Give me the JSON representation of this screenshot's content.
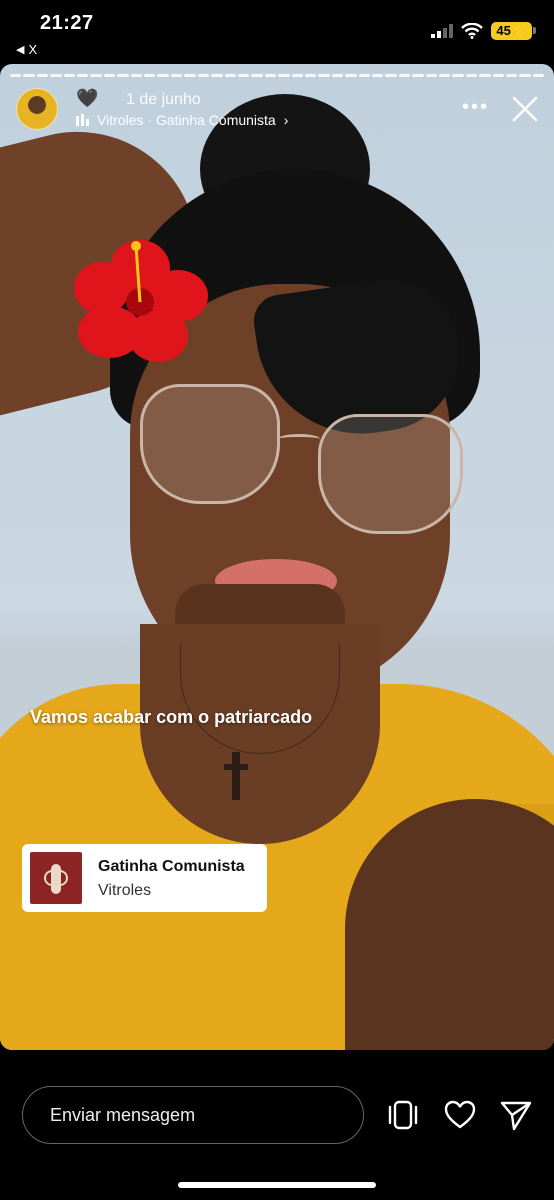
{
  "status_bar": {
    "time": "21:27",
    "back_label": "X",
    "battery": "45"
  },
  "story": {
    "progress_segments": 40,
    "progress_viewed_fraction": 1.0,
    "heart_label": "🖤",
    "date": "1 de junho",
    "music_line": "Vitroles · Gatinha Comunista",
    "caption": "Vamos acabar com o patriarcado",
    "music_sticker": {
      "title": "Gatinha Comunista",
      "artist": "Vitroles"
    }
  },
  "bottom_bar": {
    "message_placeholder": "Enviar mensagem"
  },
  "colors": {
    "shirt": "#e5a81a",
    "battery": "#f5cc1e",
    "hibiscus": "#e0141b"
  },
  "icons": {
    "back": "back-triangle-icon",
    "signal": "signal-icon",
    "wifi": "wifi-icon",
    "music": "music-bars-icon",
    "more": "more-icon",
    "close": "close-icon",
    "collab": "collab-icon",
    "like": "heart-icon",
    "send": "send-icon"
  }
}
